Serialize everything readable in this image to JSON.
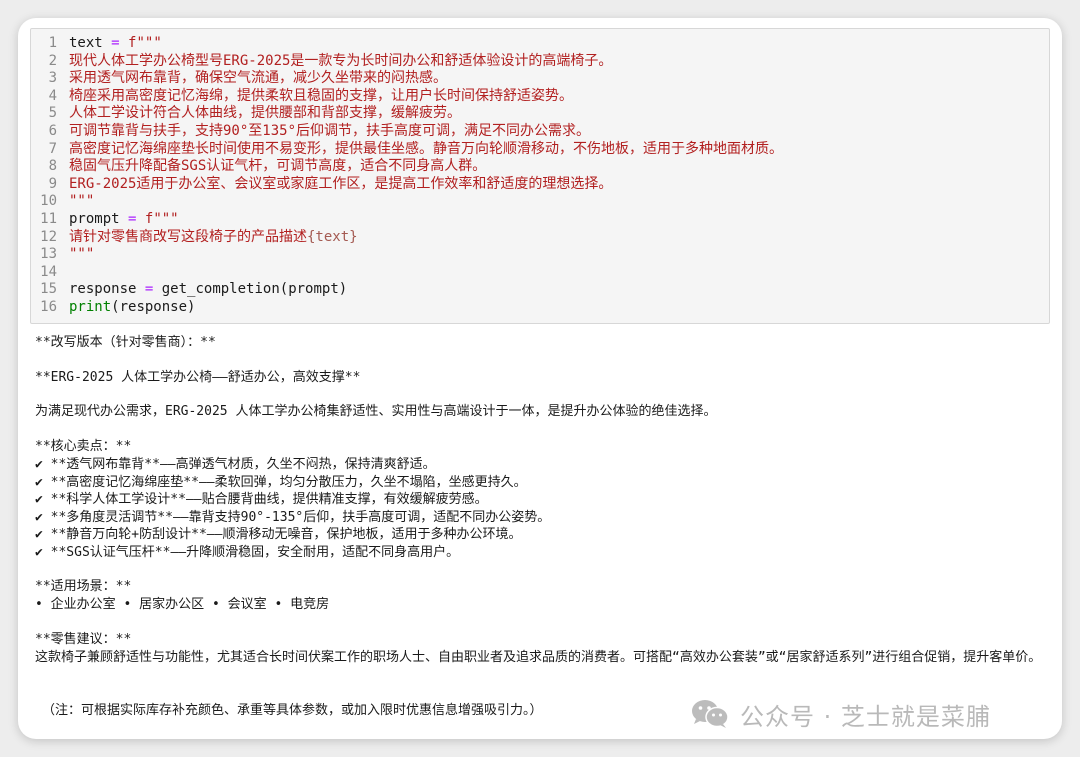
{
  "code": [
    {
      "n": "1",
      "parts": [
        [
          "name",
          "text"
        ],
        [
          "punct",
          " "
        ],
        [
          "op",
          "="
        ],
        [
          "punct",
          " "
        ],
        [
          "str",
          "f\"\"\""
        ]
      ]
    },
    {
      "n": "2",
      "parts": [
        [
          "str",
          "现代人体工学办公椅型号ERG-2025是一款专为长时间办公和舒适体验设计的高端椅子。"
        ]
      ]
    },
    {
      "n": "3",
      "parts": [
        [
          "str",
          "采用透气网布靠背，确保空气流通，减少久坐带来的闷热感。"
        ]
      ]
    },
    {
      "n": "4",
      "parts": [
        [
          "str",
          "椅座采用高密度记忆海绵，提供柔软且稳固的支撑，让用户长时间保持舒适姿势。"
        ]
      ]
    },
    {
      "n": "5",
      "parts": [
        [
          "str",
          "人体工学设计符合人体曲线，提供腰部和背部支撑，缓解疲劳。"
        ]
      ]
    },
    {
      "n": "6",
      "parts": [
        [
          "str",
          "可调节靠背与扶手，支持90°至135°后仰调节，扶手高度可调，满足不同办公需求。"
        ]
      ]
    },
    {
      "n": "7",
      "parts": [
        [
          "str",
          "高密度记忆海绵座垫长时间使用不易变形，提供最佳坐感。静音万向轮顺滑移动，不伤地板，适用于多种地面材质。"
        ]
      ]
    },
    {
      "n": "8",
      "parts": [
        [
          "str",
          "稳固气压升降配备SGS认证气杆，可调节高度，适合不同身高人群。"
        ]
      ]
    },
    {
      "n": "9",
      "parts": [
        [
          "str",
          "ERG-2025适用于办公室、会议室或家庭工作区，是提高工作效率和舒适度的理想选择。"
        ]
      ]
    },
    {
      "n": "10",
      "parts": [
        [
          "str",
          "\"\"\""
        ]
      ]
    },
    {
      "n": "11",
      "parts": [
        [
          "name",
          "prompt"
        ],
        [
          "punct",
          " "
        ],
        [
          "op",
          "="
        ],
        [
          "punct",
          " "
        ],
        [
          "str",
          "f\"\"\""
        ]
      ]
    },
    {
      "n": "12",
      "parts": [
        [
          "str",
          "请针对零售商改写这段椅子的产品描述"
        ],
        [
          "interp",
          "{text}"
        ]
      ]
    },
    {
      "n": "13",
      "parts": [
        [
          "str",
          "\"\"\""
        ]
      ]
    },
    {
      "n": "14",
      "parts": []
    },
    {
      "n": "15",
      "parts": [
        [
          "name",
          "response"
        ],
        [
          "punct",
          " "
        ],
        [
          "op",
          "="
        ],
        [
          "punct",
          " "
        ],
        [
          "fn",
          "get_completion"
        ],
        [
          "punct",
          "(prompt)"
        ]
      ]
    },
    {
      "n": "16",
      "parts": [
        [
          "builtin",
          "print"
        ],
        [
          "punct",
          "(response)"
        ]
      ]
    }
  ],
  "output": {
    "heading": "**改写版本（针对零售商）：**",
    "title": "**ERG-2025 人体工学办公椅——舒适办公，高效支撑**",
    "intro": "为满足现代办公需求，ERG-2025 人体工学办公椅集舒适性、实用性与高端设计于一体，是提升办公体验的绝佳选择。",
    "features_heading": "**核心卖点：**",
    "features": [
      "✔ **透气网布靠背**——高弹透气材质，久坐不闷热，保持清爽舒适。",
      "✔ **高密度记忆海绵座垫**——柔软回弹，均匀分散压力，久坐不塌陷，坐感更持久。",
      "✔ **科学人体工学设计**——贴合腰背曲线，提供精准支撑，有效缓解疲劳感。",
      "✔ **多角度灵活调节**——靠背支持90°-135°后仰，扶手高度可调，适配不同办公姿势。",
      "✔ **静音万向轮+防刮设计**——顺滑移动无噪音，保护地板，适用于多种办公环境。",
      "✔ **SGS认证气压杆**——升降顺滑稳固，安全耐用，适配不同身高用户。"
    ],
    "scenes_heading": "**适用场景：**",
    "scenes": "• 企业办公室 • 居家办公区 • 会议室 • 电竞房",
    "retail_heading": "**零售建议：**",
    "retail_text": "这款椅子兼顾舒适性与功能性，尤其适合长时间伏案工作的职场人士、自由职业者及追求品质的消费者。可搭配“高效办公套装”或“居家舒适系列”进行组合促销，提升客单价。",
    "note": "（注：可根据实际库存补充颜色、承重等具体参数，或加入限时优惠信息增强吸引力。）"
  },
  "watermark": {
    "text": "公众号 · 芝士就是菜脯",
    "icon": "wechat-icon"
  }
}
